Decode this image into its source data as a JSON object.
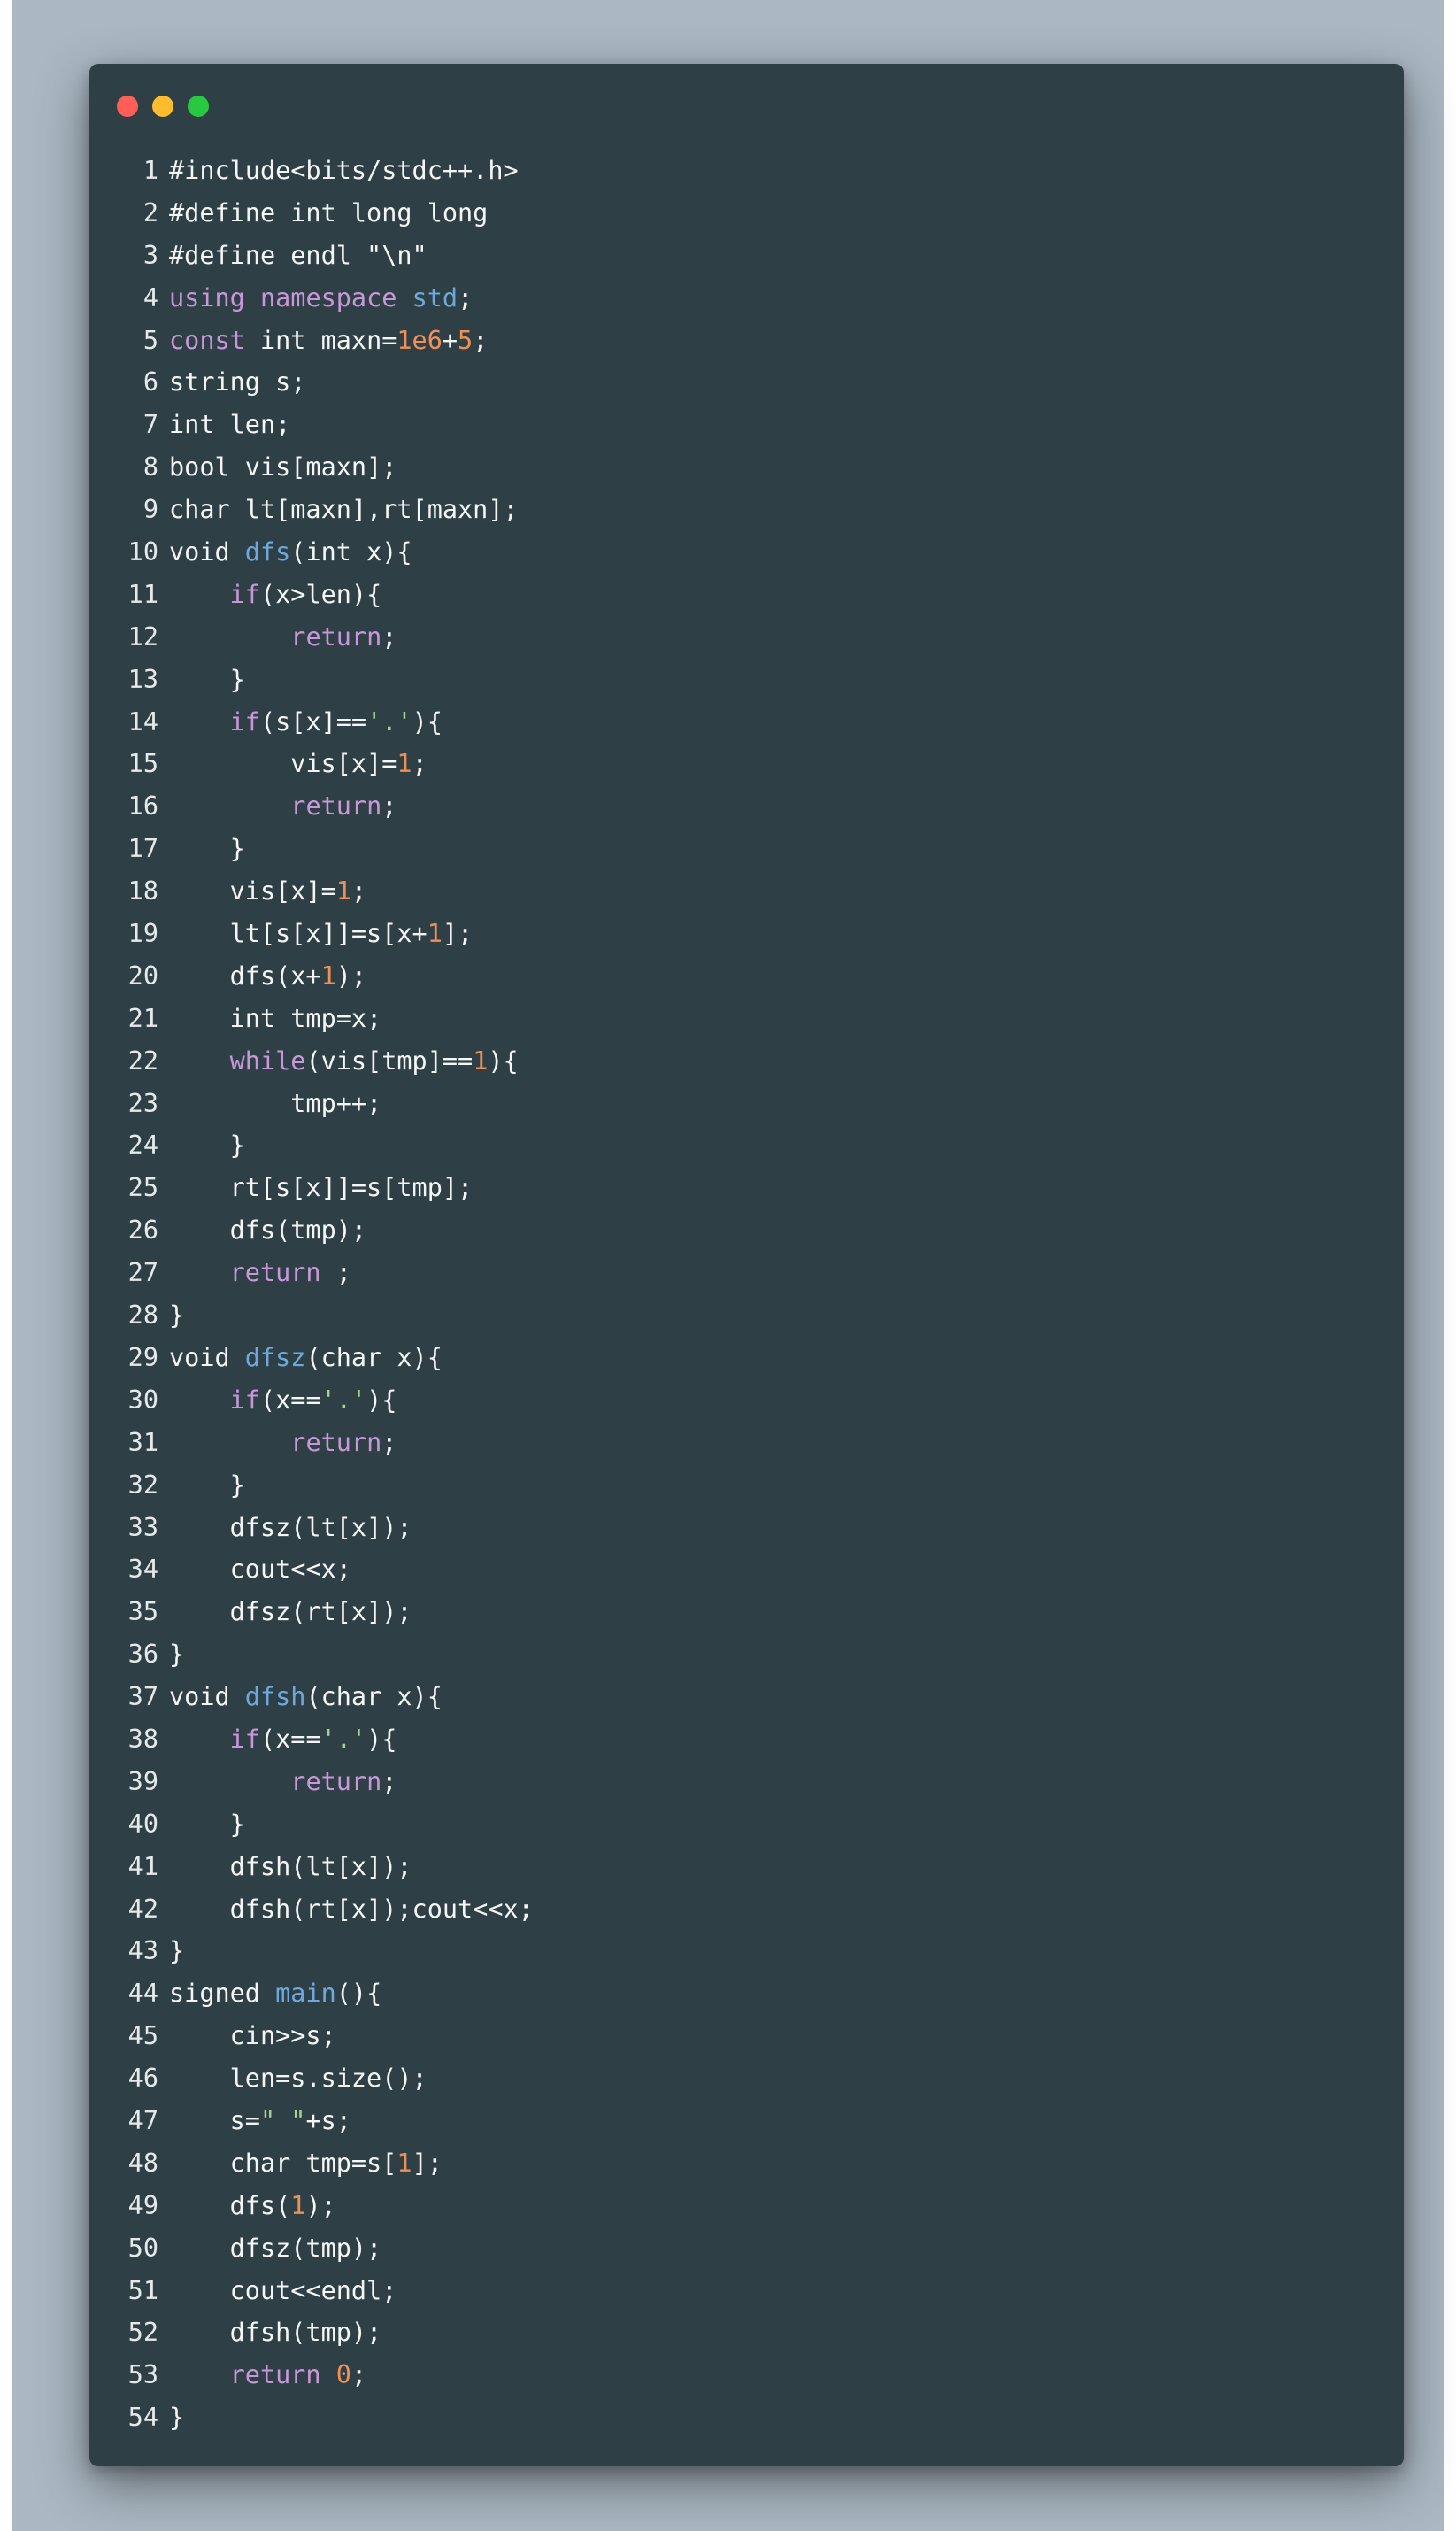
{
  "window": {
    "controls": [
      "close",
      "minimize",
      "maximize"
    ],
    "colors": {
      "background": "#2f3f46",
      "backdrop": "#abb8c3",
      "close": "#ff5f57",
      "minimize": "#febc2e",
      "maximize": "#28c840"
    }
  },
  "syntax_colors": {
    "plain": "#f4f6f6",
    "keyword": "#c797d8",
    "function": "#6fa8dc",
    "number": "#ef9057",
    "string": "#a7d590"
  },
  "code": {
    "lines": [
      {
        "num": "1",
        "tokens": [
          [
            "plain",
            "#include<bits/stdc++.h>"
          ]
        ]
      },
      {
        "num": "2",
        "tokens": [
          [
            "plain",
            "#define int long long"
          ]
        ]
      },
      {
        "num": "3",
        "tokens": [
          [
            "plain",
            "#define endl \"\\n\""
          ]
        ]
      },
      {
        "num": "4",
        "tokens": [
          [
            "kw",
            "using"
          ],
          [
            "plain",
            " "
          ],
          [
            "kw",
            "namespace"
          ],
          [
            "plain",
            " "
          ],
          [
            "fn",
            "std"
          ],
          [
            "plain",
            ";"
          ]
        ]
      },
      {
        "num": "5",
        "tokens": [
          [
            "kw",
            "const"
          ],
          [
            "plain",
            " int maxn="
          ],
          [
            "num",
            "1e6"
          ],
          [
            "plain",
            "+"
          ],
          [
            "num",
            "5"
          ],
          [
            "plain",
            ";"
          ]
        ]
      },
      {
        "num": "6",
        "tokens": [
          [
            "plain",
            "string s;"
          ]
        ]
      },
      {
        "num": "7",
        "tokens": [
          [
            "plain",
            "int len;"
          ]
        ]
      },
      {
        "num": "8",
        "tokens": [
          [
            "plain",
            "bool vis[maxn];"
          ]
        ]
      },
      {
        "num": "9",
        "tokens": [
          [
            "plain",
            "char lt[maxn],rt[maxn];"
          ]
        ]
      },
      {
        "num": "10",
        "tokens": [
          [
            "plain",
            "void "
          ],
          [
            "fn",
            "dfs"
          ],
          [
            "plain",
            "(int x){"
          ]
        ]
      },
      {
        "num": "11",
        "tokens": [
          [
            "plain",
            "    "
          ],
          [
            "kw",
            "if"
          ],
          [
            "plain",
            "(x>len){"
          ]
        ]
      },
      {
        "num": "12",
        "tokens": [
          [
            "plain",
            "        "
          ],
          [
            "kw",
            "return"
          ],
          [
            "plain",
            ";"
          ]
        ]
      },
      {
        "num": "13",
        "tokens": [
          [
            "plain",
            "    }"
          ]
        ]
      },
      {
        "num": "14",
        "tokens": [
          [
            "plain",
            "    "
          ],
          [
            "kw",
            "if"
          ],
          [
            "plain",
            "(s[x]=="
          ],
          [
            "str",
            "'.'"
          ],
          [
            "plain",
            "){"
          ]
        ]
      },
      {
        "num": "15",
        "tokens": [
          [
            "plain",
            "        vis[x]="
          ],
          [
            "num",
            "1"
          ],
          [
            "plain",
            ";"
          ]
        ]
      },
      {
        "num": "16",
        "tokens": [
          [
            "plain",
            "        "
          ],
          [
            "kw",
            "return"
          ],
          [
            "plain",
            ";"
          ]
        ]
      },
      {
        "num": "17",
        "tokens": [
          [
            "plain",
            "    }"
          ]
        ]
      },
      {
        "num": "18",
        "tokens": [
          [
            "plain",
            "    vis[x]="
          ],
          [
            "num",
            "1"
          ],
          [
            "plain",
            ";"
          ]
        ]
      },
      {
        "num": "19",
        "tokens": [
          [
            "plain",
            "    lt[s[x]]=s[x+"
          ],
          [
            "num",
            "1"
          ],
          [
            "plain",
            "];"
          ]
        ]
      },
      {
        "num": "20",
        "tokens": [
          [
            "plain",
            "    dfs(x+"
          ],
          [
            "num",
            "1"
          ],
          [
            "plain",
            ");"
          ]
        ]
      },
      {
        "num": "21",
        "tokens": [
          [
            "plain",
            "    int tmp=x;"
          ]
        ]
      },
      {
        "num": "22",
        "tokens": [
          [
            "plain",
            "    "
          ],
          [
            "kw",
            "while"
          ],
          [
            "plain",
            "(vis[tmp]=="
          ],
          [
            "num",
            "1"
          ],
          [
            "plain",
            "){"
          ]
        ]
      },
      {
        "num": "23",
        "tokens": [
          [
            "plain",
            "        tmp++;"
          ]
        ]
      },
      {
        "num": "24",
        "tokens": [
          [
            "plain",
            "    }"
          ]
        ]
      },
      {
        "num": "25",
        "tokens": [
          [
            "plain",
            "    rt[s[x]]=s[tmp];"
          ]
        ]
      },
      {
        "num": "26",
        "tokens": [
          [
            "plain",
            "    dfs(tmp);"
          ]
        ]
      },
      {
        "num": "27",
        "tokens": [
          [
            "plain",
            "    "
          ],
          [
            "kw",
            "return"
          ],
          [
            "plain",
            " ;"
          ]
        ]
      },
      {
        "num": "28",
        "tokens": [
          [
            "plain",
            "}"
          ]
        ]
      },
      {
        "num": "29",
        "tokens": [
          [
            "plain",
            "void "
          ],
          [
            "fn",
            "dfsz"
          ],
          [
            "plain",
            "(char x){"
          ]
        ]
      },
      {
        "num": "30",
        "tokens": [
          [
            "plain",
            "    "
          ],
          [
            "kw",
            "if"
          ],
          [
            "plain",
            "(x=="
          ],
          [
            "str",
            "'.'"
          ],
          [
            "plain",
            "){"
          ]
        ]
      },
      {
        "num": "31",
        "tokens": [
          [
            "plain",
            "        "
          ],
          [
            "kw",
            "return"
          ],
          [
            "plain",
            ";"
          ]
        ]
      },
      {
        "num": "32",
        "tokens": [
          [
            "plain",
            "    }"
          ]
        ]
      },
      {
        "num": "33",
        "tokens": [
          [
            "plain",
            "    dfsz(lt[x]);"
          ]
        ]
      },
      {
        "num": "34",
        "tokens": [
          [
            "plain",
            "    cout<<x;"
          ]
        ]
      },
      {
        "num": "35",
        "tokens": [
          [
            "plain",
            "    dfsz(rt[x]);"
          ]
        ]
      },
      {
        "num": "36",
        "tokens": [
          [
            "plain",
            "}"
          ]
        ]
      },
      {
        "num": "37",
        "tokens": [
          [
            "plain",
            "void "
          ],
          [
            "fn",
            "dfsh"
          ],
          [
            "plain",
            "(char x){"
          ]
        ]
      },
      {
        "num": "38",
        "tokens": [
          [
            "plain",
            "    "
          ],
          [
            "kw",
            "if"
          ],
          [
            "plain",
            "(x=="
          ],
          [
            "str",
            "'.'"
          ],
          [
            "plain",
            "){"
          ]
        ]
      },
      {
        "num": "39",
        "tokens": [
          [
            "plain",
            "        "
          ],
          [
            "kw",
            "return"
          ],
          [
            "plain",
            ";"
          ]
        ]
      },
      {
        "num": "40",
        "tokens": [
          [
            "plain",
            "    }"
          ]
        ]
      },
      {
        "num": "41",
        "tokens": [
          [
            "plain",
            "    dfsh(lt[x]);"
          ]
        ]
      },
      {
        "num": "42",
        "tokens": [
          [
            "plain",
            "    dfsh(rt[x]);cout<<x;"
          ]
        ]
      },
      {
        "num": "43",
        "tokens": [
          [
            "plain",
            "}"
          ]
        ]
      },
      {
        "num": "44",
        "tokens": [
          [
            "plain",
            "signed "
          ],
          [
            "fn",
            "main"
          ],
          [
            "plain",
            "(){"
          ]
        ]
      },
      {
        "num": "45",
        "tokens": [
          [
            "plain",
            "    cin>>s;"
          ]
        ]
      },
      {
        "num": "46",
        "tokens": [
          [
            "plain",
            "    len=s.size();"
          ]
        ]
      },
      {
        "num": "47",
        "tokens": [
          [
            "plain",
            "    s="
          ],
          [
            "str",
            "\" \""
          ],
          [
            "plain",
            "+s;"
          ]
        ]
      },
      {
        "num": "48",
        "tokens": [
          [
            "plain",
            "    char tmp=s["
          ],
          [
            "num",
            "1"
          ],
          [
            "plain",
            "];"
          ]
        ]
      },
      {
        "num": "49",
        "tokens": [
          [
            "plain",
            "    dfs("
          ],
          [
            "num",
            "1"
          ],
          [
            "plain",
            ");"
          ]
        ]
      },
      {
        "num": "50",
        "tokens": [
          [
            "plain",
            "    dfsz(tmp);"
          ]
        ]
      },
      {
        "num": "51",
        "tokens": [
          [
            "plain",
            "    cout<<endl;"
          ]
        ]
      },
      {
        "num": "52",
        "tokens": [
          [
            "plain",
            "    dfsh(tmp);"
          ]
        ]
      },
      {
        "num": "53",
        "tokens": [
          [
            "plain",
            "    "
          ],
          [
            "kw",
            "return"
          ],
          [
            "plain",
            " "
          ],
          [
            "num",
            "0"
          ],
          [
            "plain",
            ";"
          ]
        ]
      },
      {
        "num": "54",
        "tokens": [
          [
            "plain",
            "}"
          ]
        ]
      }
    ]
  }
}
